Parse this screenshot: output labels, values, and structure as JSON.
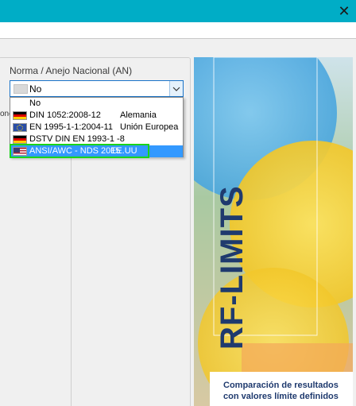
{
  "window": {
    "close_icon": "close-icon"
  },
  "norma_group": {
    "label": "Norma / Anejo Nacional (AN)",
    "left_clipped_text": "one",
    "combo": {
      "value": "No",
      "flag": "none"
    },
    "options": [
      {
        "code": "No",
        "country": "",
        "flag": "none",
        "selected": false
      },
      {
        "code": "DIN 1052:2008-12",
        "country": "Alemania",
        "flag": "de",
        "selected": false
      },
      {
        "code": "EN 1995-1-1:2004-11",
        "country": "Unión Europea",
        "flag": "eu",
        "selected": false
      },
      {
        "code": "DSTV DIN EN 1993-1 -8",
        "country": "",
        "flag": "de",
        "selected": false
      },
      {
        "code": "ANSI/AWC - NDS 2015",
        "country": "EE.UU",
        "flag": "us",
        "selected": true
      }
    ]
  },
  "banner": {
    "product": "RF-LIMITS",
    "caption_line1": "Comparación de resultados",
    "caption_line2": "con valores límite definidos",
    "colors": {
      "title": "#1f3a6e",
      "yellow": "#f6d23a",
      "blue": "#5ab4e6",
      "orange": "#f3a85a"
    }
  },
  "colors": {
    "titlebar": "#00adc6",
    "selection": "#3399ff",
    "highlight": "#19d419"
  }
}
